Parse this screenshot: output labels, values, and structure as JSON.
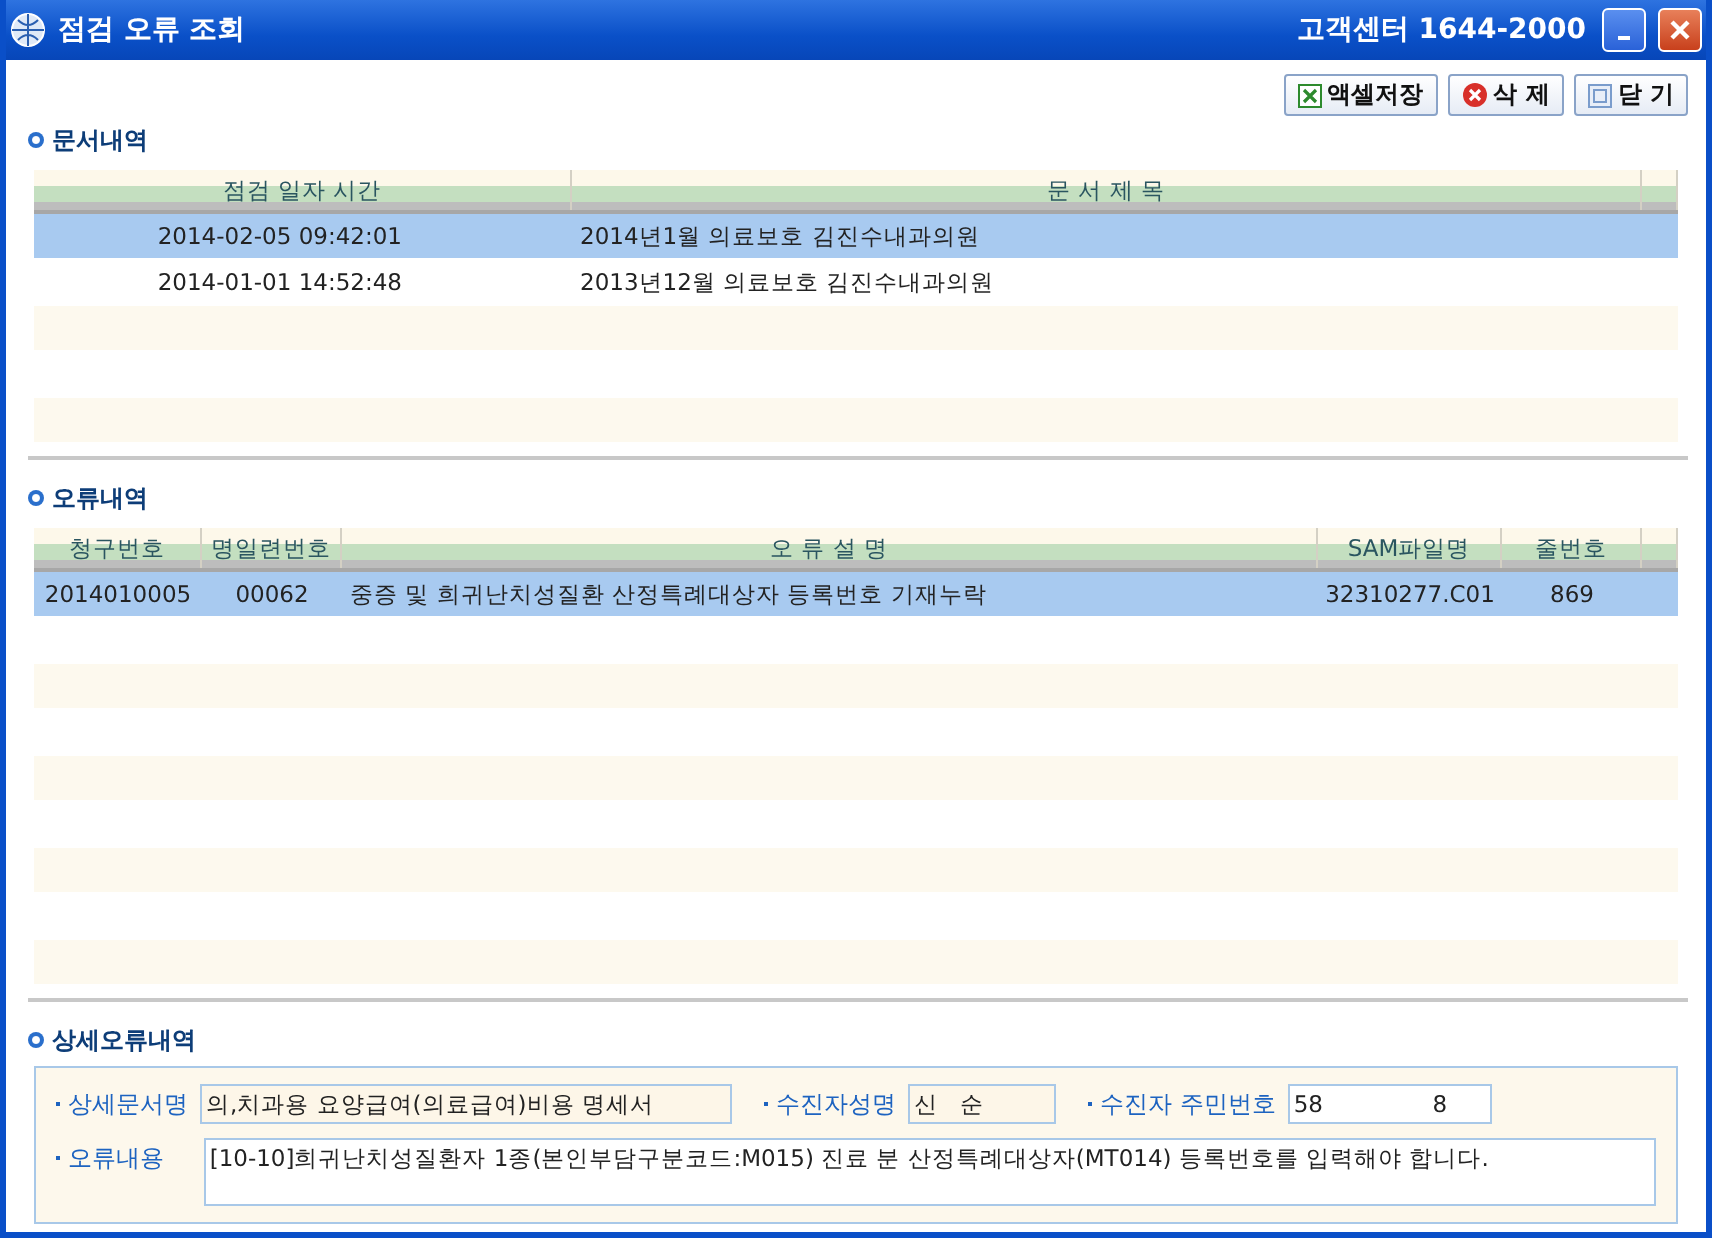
{
  "window": {
    "title": "점검 오류 조회",
    "contact": "고객센터 1644-2000"
  },
  "buttons": [
    {
      "label": "액셀저장",
      "kind": "excel"
    },
    {
      "label": "삭 제",
      "kind": "delete"
    },
    {
      "label": "닫 기",
      "kind": "close"
    }
  ],
  "documents": {
    "heading": "문서내역",
    "columns": [
      "점검 일자 시간",
      "문 서 제 목"
    ],
    "rows": [
      {
        "cells": [
          "2014-02-05 09:42:01",
          "2014년1월 의료보호 김진수내과의원"
        ],
        "selected": true
      },
      {
        "cells": [
          "2014-01-01 14:52:48",
          "2013년12월 의료보호 김진수내과의원"
        ],
        "selected": false
      }
    ]
  },
  "errors": {
    "heading": "오류내역",
    "columns": [
      "청구번호",
      "명일련번호",
      "오 류 설 명",
      "SAM파일명",
      "줄번호"
    ],
    "rows": [
      {
        "cells": [
          "2014010005",
          "00062",
          "중증 및 희귀난치성질환 산정특례대상자 등록번호 기재누락",
          "32310277.C01",
          "869"
        ],
        "selected": true
      }
    ]
  },
  "detail": {
    "heading": "상세오류내역",
    "document_name": {
      "label": "상세문서명",
      "value": "의,치과용 요양급여(의료급여)비용 명세서"
    },
    "patient_name": {
      "label": "수진자성명",
      "value": "신   순"
    },
    "patient_id": {
      "label": "수진자 주민번호",
      "value": "58               8"
    },
    "error_content": {
      "label": "오류내용",
      "value": "[10-10]희귀난치성질환자 1종(본인부담구분코드:M015) 진료 분 산정특례대상자(MT014) 등록번호를 입력해야 합니다."
    }
  }
}
